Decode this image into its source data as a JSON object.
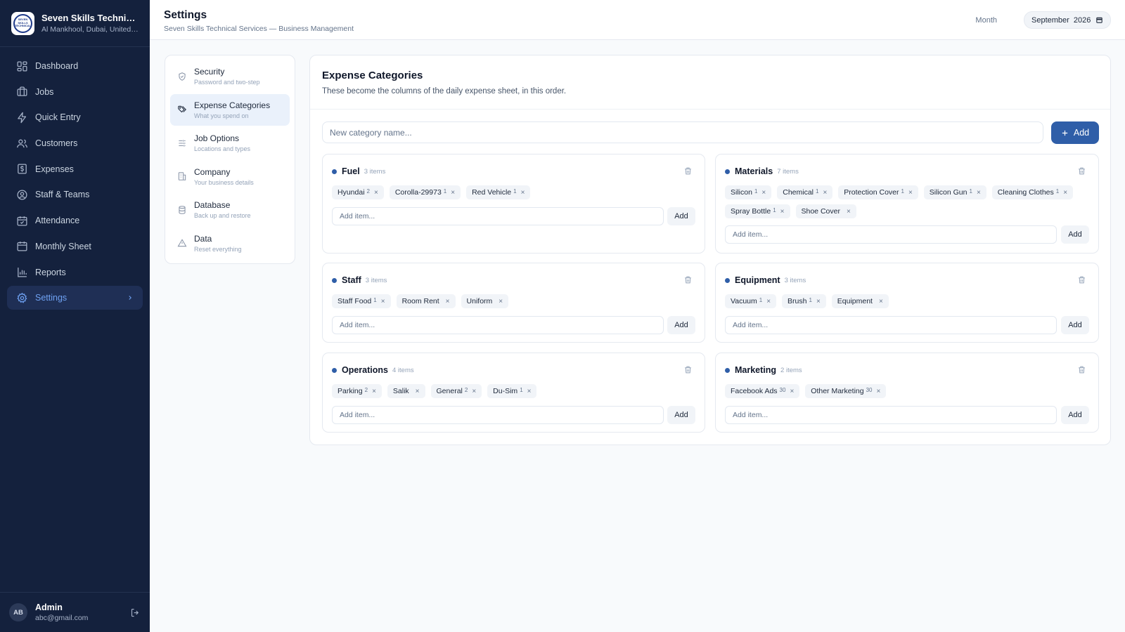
{
  "company": {
    "name": "Seven Skills Technical Services",
    "address": "Al Mankhool, Dubai, United Arab Emirates",
    "logo_text": "SEVEN SKILLS TECHNICAL"
  },
  "sidebar": {
    "items": [
      {
        "label": "Dashboard",
        "icon": "grid-icon"
      },
      {
        "label": "Jobs",
        "icon": "briefcase-icon"
      },
      {
        "label": "Quick Entry",
        "icon": "bolt-icon"
      },
      {
        "label": "Customers",
        "icon": "users-icon"
      },
      {
        "label": "Expenses",
        "icon": "dollar-icon"
      },
      {
        "label": "Staff & Teams",
        "icon": "user-circle-icon"
      },
      {
        "label": "Attendance",
        "icon": "calendar-check-icon"
      },
      {
        "label": "Monthly Sheet",
        "icon": "calendar-icon"
      },
      {
        "label": "Reports",
        "icon": "bar-chart-icon"
      },
      {
        "label": "Settings",
        "icon": "gear-icon",
        "active": true
      }
    ]
  },
  "user": {
    "initials": "AB",
    "name": "Admin",
    "email": "abc@gmail.com"
  },
  "header": {
    "title": "Settings",
    "subtitle": "Seven Skills Technical Services — Business Management",
    "month_label": "Month",
    "month_value": "September  2026"
  },
  "settings_nav": [
    {
      "label": "Security",
      "desc": "Password and two-step",
      "icon": "shield-icon"
    },
    {
      "label": "Expense Categories",
      "desc": "What you spend on",
      "icon": "tags-icon",
      "active": true
    },
    {
      "label": "Job Options",
      "desc": "Locations and types",
      "icon": "sliders-icon"
    },
    {
      "label": "Company",
      "desc": "Your business details",
      "icon": "building-icon"
    },
    {
      "label": "Database",
      "desc": "Back up and restore",
      "icon": "database-icon"
    },
    {
      "label": "Data",
      "desc": "Reset everything",
      "icon": "warning-icon"
    }
  ],
  "main": {
    "title": "Expense Categories",
    "description": "These become the columns of the daily expense sheet, in this order.",
    "new_category_placeholder": "New category name...",
    "add_label": "Add",
    "item_placeholder": "Add item...",
    "item_add_label": "Add",
    "remove_glyph": "×",
    "categories": [
      {
        "name": "Fuel",
        "count": "3 items",
        "items": [
          {
            "label": "Hyundai",
            "n": "2"
          },
          {
            "label": "Corolla-29973",
            "n": "1"
          },
          {
            "label": "Red Vehicle",
            "n": "1"
          }
        ]
      },
      {
        "name": "Materials",
        "count": "7 items",
        "items": [
          {
            "label": "Silicon",
            "n": "1"
          },
          {
            "label": "Chemical",
            "n": "1"
          },
          {
            "label": "Protection Cover",
            "n": "1"
          },
          {
            "label": "Silicon Gun",
            "n": "1"
          },
          {
            "label": "Cleaning Clothes",
            "n": "1"
          },
          {
            "label": "Spray Bottle",
            "n": "1"
          },
          {
            "label": "Shoe Cover",
            "n": ""
          }
        ]
      },
      {
        "name": "Staff",
        "count": "3 items",
        "items": [
          {
            "label": "Staff Food",
            "n": "1"
          },
          {
            "label": "Room Rent",
            "n": ""
          },
          {
            "label": "Uniform",
            "n": ""
          }
        ]
      },
      {
        "name": "Equipment",
        "count": "3 items",
        "items": [
          {
            "label": "Vacuum",
            "n": "1"
          },
          {
            "label": "Brush",
            "n": "1"
          },
          {
            "label": "Equipment",
            "n": ""
          }
        ]
      },
      {
        "name": "Operations",
        "count": "4 items",
        "items": [
          {
            "label": "Parking",
            "n": "2"
          },
          {
            "label": "Salik",
            "n": ""
          },
          {
            "label": "General",
            "n": "2"
          },
          {
            "label": "Du-Sim",
            "n": "1"
          }
        ]
      },
      {
        "name": "Marketing",
        "count": "2 items",
        "items": [
          {
            "label": "Facebook Ads",
            "n": "30"
          },
          {
            "label": "Other Marketing",
            "n": "30"
          }
        ]
      }
    ]
  },
  "colors": {
    "sidebar_bg": "#14213d",
    "accent": "#2f5ea8",
    "active_nav_text": "#6ea1f2"
  }
}
